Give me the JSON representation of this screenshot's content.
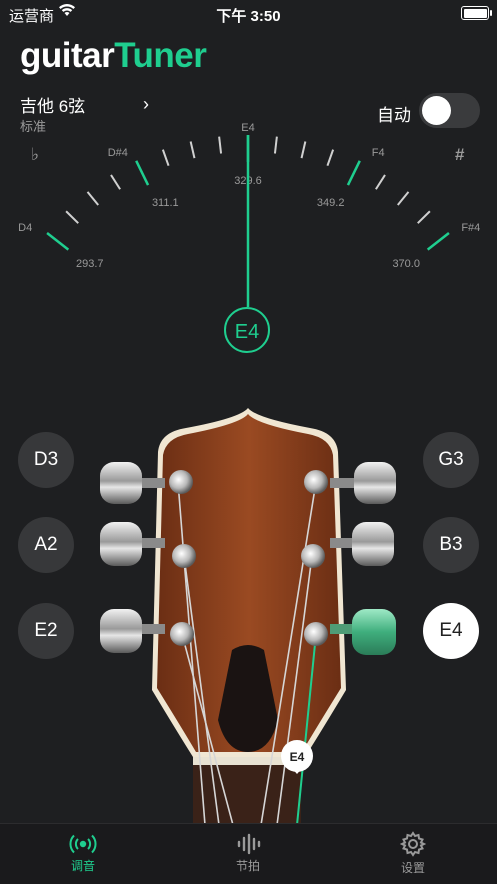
{
  "status": {
    "carrier": "运营商",
    "time": "下午 3:50"
  },
  "header": {
    "logo_part1": "guitar",
    "logo_part2": "Tuner"
  },
  "instrument": {
    "name": "吉他 6弦",
    "tuning": "标准",
    "chevron": "›"
  },
  "auto": {
    "label": "自动",
    "enabled": false
  },
  "meter": {
    "flat_symbol": "♭",
    "sharp_symbol": "#",
    "notes": [
      {
        "note": "D4",
        "freq": "293.7"
      },
      {
        "note": "D#4",
        "freq": "311.1"
      },
      {
        "note": "E4",
        "freq": "329.6"
      },
      {
        "note": "F4",
        "freq": "349.2"
      },
      {
        "note": "F#4",
        "freq": "370.0"
      }
    ],
    "current_note": "E4"
  },
  "pegs": {
    "left": [
      "D3",
      "A2",
      "E2"
    ],
    "right": [
      "G3",
      "B3",
      "E4"
    ],
    "active": "E4"
  },
  "string_marker": "E4",
  "tabs": [
    {
      "label": "调音",
      "icon": "tuner-icon",
      "active": true
    },
    {
      "label": "节拍",
      "icon": "metronome-icon",
      "active": false
    },
    {
      "label": "设置",
      "icon": "gear-icon",
      "active": false
    }
  ],
  "colors": {
    "accent": "#1fce8f",
    "background": "#1e1f21",
    "wood": "#8a3f1d"
  }
}
